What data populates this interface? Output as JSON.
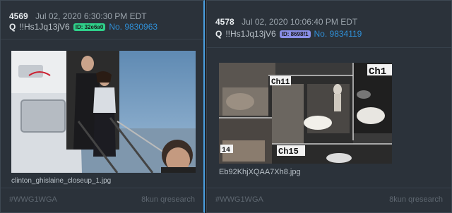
{
  "posts": [
    {
      "number": "4569",
      "date": "Jul 02, 2020 6:30:30 PM EDT",
      "q": "Q",
      "tripcode": "!!Hs1Jq13jV6",
      "id_badge": "ID: 32e6a0",
      "id_color": "#2fd08a",
      "post_no": "No. 9830963",
      "image_filename": "clinton_ghislaine_closeup_1.jpg",
      "hashtag": "#WWG1WGA",
      "board": "8kun qresearch"
    },
    {
      "number": "4578",
      "date": "Jul 02, 2020 10:06:40 PM EDT",
      "q": "Q",
      "tripcode": "!!Hs1Jq13jV6",
      "id_badge": "ID: 8698f1",
      "id_color": "#8a8fe8",
      "post_no": "No. 9834119",
      "image_filename": "Eb92KhjXQAA7Xh8.jpg",
      "hashtag": "#WWG1WGA",
      "board": "8kun qresearch",
      "cctv_labels": [
        "Ch11",
        "Ch1",
        "14",
        "Ch15"
      ]
    }
  ]
}
